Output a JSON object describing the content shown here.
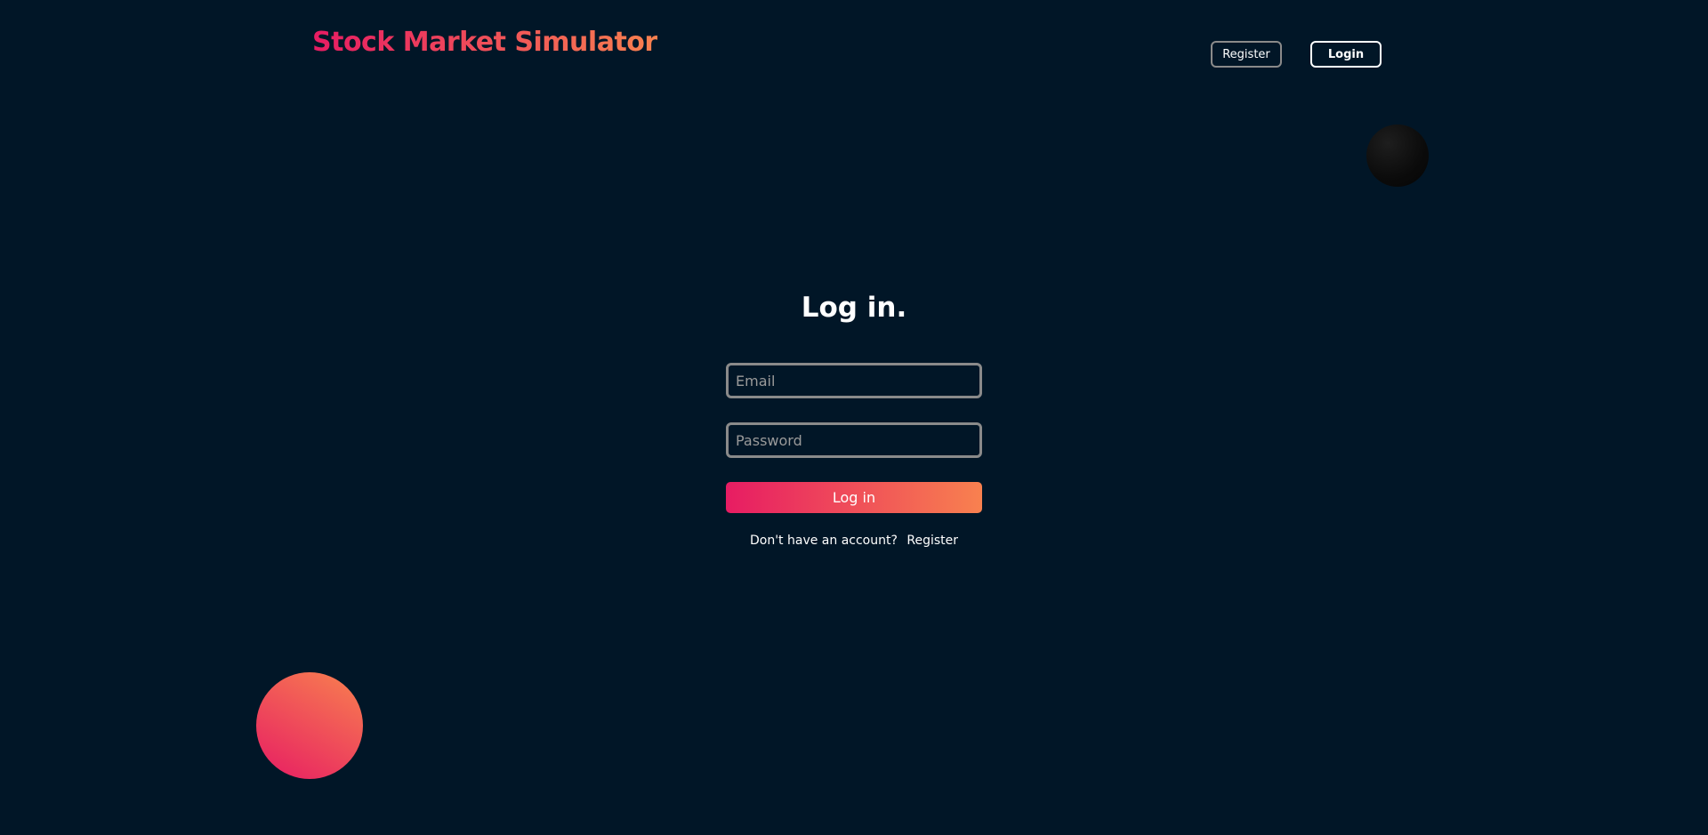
{
  "header": {
    "brand": "Stock Market Simulator",
    "register_label": "Register",
    "login_label": "Login"
  },
  "form": {
    "title": "Log in.",
    "email_placeholder": "Email",
    "password_placeholder": "Password",
    "submit_label": "Log in",
    "prompt_text": "Don't have an account?",
    "register_link": "Register"
  },
  "colors": {
    "background": "#011627",
    "accent_start": "#e71c63",
    "accent_end": "#f8814f",
    "text": "#ffffff"
  }
}
